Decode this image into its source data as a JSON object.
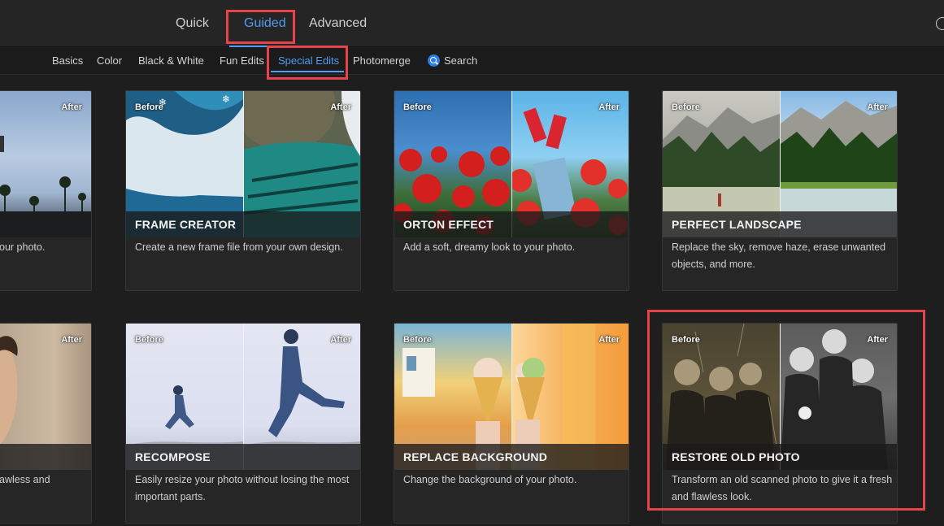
{
  "modes": {
    "quick": "Quick",
    "guided": "Guided",
    "advanced": "Advanced"
  },
  "categories": {
    "basics": "Basics",
    "color": "Color",
    "black_white": "Black & White",
    "fun_edits": "Fun Edits",
    "special_edits": "Special Edits",
    "photomerge": "Photomerge",
    "search": "Search"
  },
  "labels": {
    "before": "Before",
    "after": "After"
  },
  "cards": {
    "row1_partial": {
      "desc": "our photo."
    },
    "frame_creator": {
      "title": "FRAME CREATOR",
      "desc": "Create a new frame file from your own design."
    },
    "orton_effect": {
      "title": "ORTON EFFECT",
      "desc": "Add a soft, dreamy look to your photo."
    },
    "perfect_landscape": {
      "title": "PERFECT LANDSCAPE",
      "desc": "Replace the sky, remove haze, erase unwanted objects, and more."
    },
    "row2_partial": {
      "desc": "awless and"
    },
    "recompose": {
      "title": "RECOMPOSE",
      "desc": "Easily resize your photo without losing the most important parts."
    },
    "replace_background": {
      "title": "REPLACE BACKGROUND",
      "desc": "Change the background of your photo."
    },
    "restore_old_photo": {
      "title": "RESTORE OLD PHOTO",
      "desc": "Transform an old scanned photo to give it a fresh and flawless look."
    }
  },
  "colors": {
    "accent": "#4f9cf2",
    "highlight": "#e5444b",
    "background": "#1e1e1e"
  }
}
